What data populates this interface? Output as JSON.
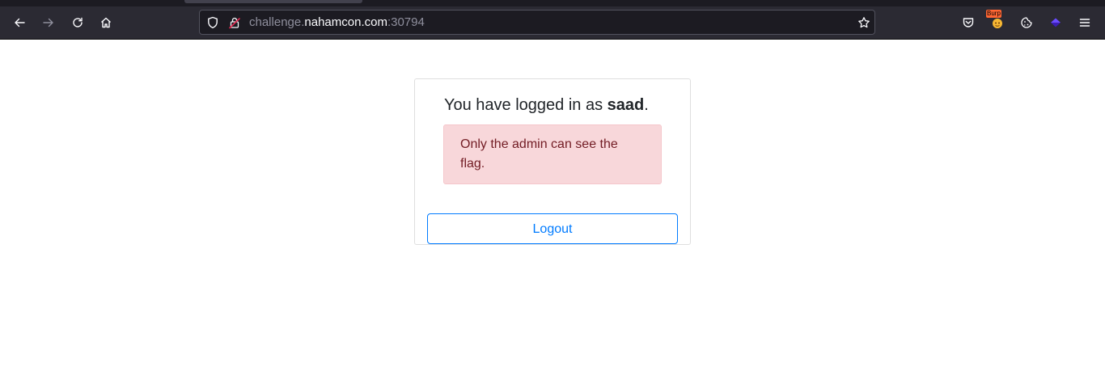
{
  "browser": {
    "url": {
      "prefix": "challenge.",
      "domain": "nahamcon.com",
      "port": ":30794"
    },
    "burp_badge": "Burp",
    "colors": {
      "chrome_bg": "#2b2a33",
      "urlbar_bg": "#1c1b22",
      "icon": "#fbfbfe"
    }
  },
  "page": {
    "login_prefix": "You have logged in as ",
    "username": "saad",
    "login_suffix": ".",
    "alert_text": "Only the admin can see the flag.",
    "logout_label": "Logout",
    "colors": {
      "alert_bg": "#f8d7da",
      "alert_text": "#721c24",
      "primary": "#007bff"
    }
  }
}
